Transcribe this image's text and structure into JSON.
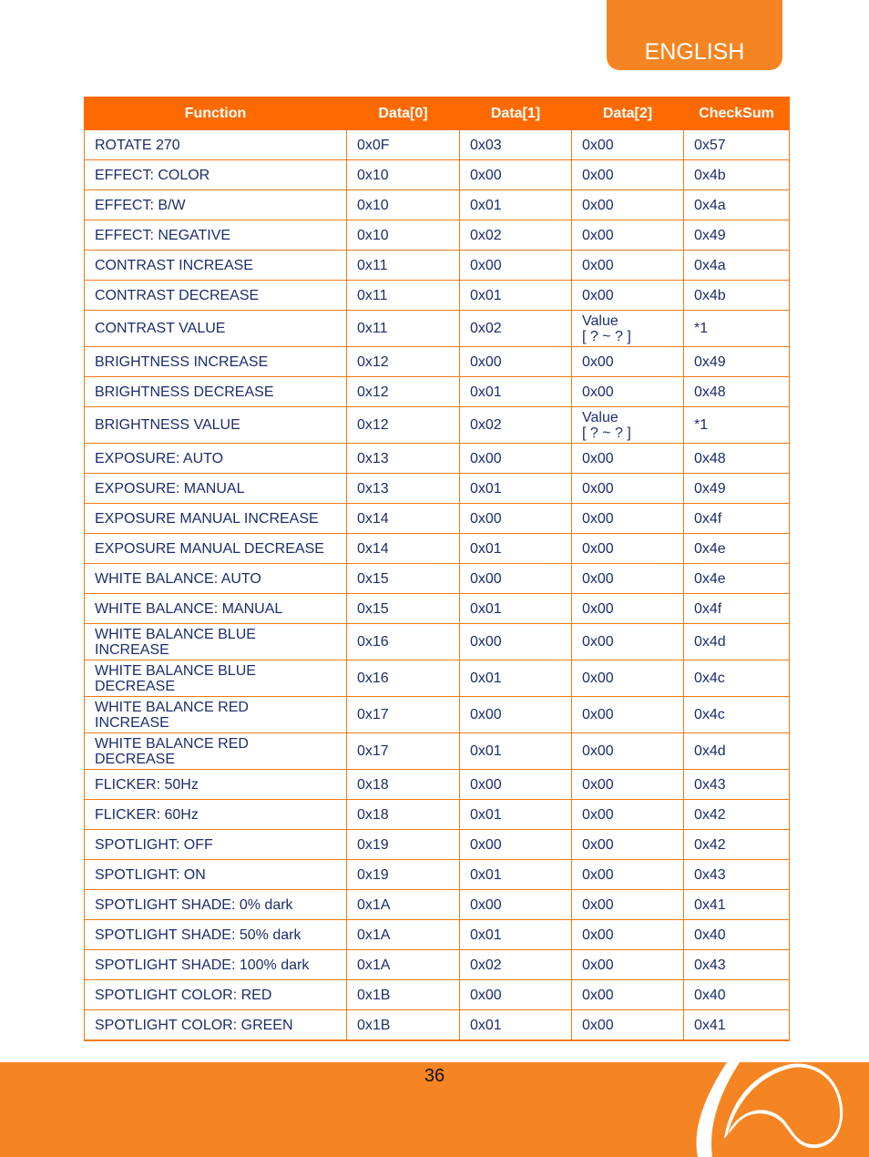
{
  "header": {
    "language_tab": "ENGLISH"
  },
  "table": {
    "columns": [
      "Function",
      "Data[0]",
      "Data[1]",
      "Data[2]",
      "CheckSum"
    ],
    "rows": [
      {
        "function": "ROTATE 270",
        "d0": "0x0F",
        "d1": "0x03",
        "d2": "0x00",
        "checksum": "0x57"
      },
      {
        "function": "EFFECT: COLOR",
        "d0": "0x10",
        "d1": "0x00",
        "d2": "0x00",
        "checksum": "0x4b"
      },
      {
        "function": "EFFECT: B/W",
        "d0": "0x10",
        "d1": "0x01",
        "d2": "0x00",
        "checksum": "0x4a"
      },
      {
        "function": "EFFECT: NEGATIVE",
        "d0": "0x10",
        "d1": "0x02",
        "d2": "0x00",
        "checksum": "0x49"
      },
      {
        "function": "CONTRAST INCREASE",
        "d0": "0x11",
        "d1": "0x00",
        "d2": "0x00",
        "checksum": "0x4a"
      },
      {
        "function": "CONTRAST DECREASE",
        "d0": "0x11",
        "d1": "0x01",
        "d2": "0x00",
        "checksum": "0x4b"
      },
      {
        "function": "CONTRAST VALUE",
        "d0": "0x11",
        "d1": "0x02",
        "d2": "Value\n[ ? ~ ? ]",
        "checksum": "*1"
      },
      {
        "function": "BRIGHTNESS INCREASE",
        "d0": "0x12",
        "d1": "0x00",
        "d2": "0x00",
        "checksum": "0x49"
      },
      {
        "function": "BRIGHTNESS DECREASE",
        "d0": "0x12",
        "d1": "0x01",
        "d2": "0x00",
        "checksum": "0x48"
      },
      {
        "function": "BRIGHTNESS VALUE",
        "d0": "0x12",
        "d1": "0x02",
        "d2": "Value\n[ ? ~ ? ]",
        "checksum": "*1"
      },
      {
        "function": "EXPOSURE: AUTO",
        "d0": "0x13",
        "d1": "0x00",
        "d2": "0x00",
        "checksum": "0x48"
      },
      {
        "function": "EXPOSURE: MANUAL",
        "d0": "0x13",
        "d1": "0x01",
        "d2": "0x00",
        "checksum": "0x49"
      },
      {
        "function": "EXPOSURE MANUAL INCREASE",
        "d0": "0x14",
        "d1": "0x00",
        "d2": "0x00",
        "checksum": "0x4f"
      },
      {
        "function": "EXPOSURE MANUAL DECREASE",
        "d0": "0x14",
        "d1": "0x01",
        "d2": "0x00",
        "checksum": "0x4e"
      },
      {
        "function": "WHITE BALANCE: AUTO",
        "d0": "0x15",
        "d1": "0x00",
        "d2": "0x00",
        "checksum": "0x4e"
      },
      {
        "function": "WHITE BALANCE: MANUAL",
        "d0": "0x15",
        "d1": "0x01",
        "d2": "0x00",
        "checksum": "0x4f"
      },
      {
        "function": "WHITE BALANCE BLUE INCREASE",
        "d0": "0x16",
        "d1": "0x00",
        "d2": "0x00",
        "checksum": "0x4d"
      },
      {
        "function": "WHITE BALANCE BLUE DECREASE",
        "d0": "0x16",
        "d1": "0x01",
        "d2": "0x00",
        "checksum": "0x4c"
      },
      {
        "function": "WHITE BALANCE RED INCREASE",
        "d0": "0x17",
        "d1": "0x00",
        "d2": "0x00",
        "checksum": "0x4c"
      },
      {
        "function": "WHITE BALANCE RED DECREASE",
        "d0": "0x17",
        "d1": "0x01",
        "d2": "0x00",
        "checksum": "0x4d"
      },
      {
        "function": "FLICKER: 50Hz",
        "d0": "0x18",
        "d1": "0x00",
        "d2": "0x00",
        "checksum": "0x43"
      },
      {
        "function": "FLICKER: 60Hz",
        "d0": "0x18",
        "d1": "0x01",
        "d2": "0x00",
        "checksum": "0x42"
      },
      {
        "function": "SPOTLIGHT: OFF",
        "d0": "0x19",
        "d1": "0x00",
        "d2": "0x00",
        "checksum": "0x42"
      },
      {
        "function": "SPOTLIGHT: ON",
        "d0": "0x19",
        "d1": "0x01",
        "d2": "0x00",
        "checksum": "0x43"
      },
      {
        "function": "SPOTLIGHT SHADE: 0% dark",
        "d0": "0x1A",
        "d1": "0x00",
        "d2": "0x00",
        "checksum": "0x41"
      },
      {
        "function": "SPOTLIGHT SHADE: 50% dark",
        "d0": "0x1A",
        "d1": "0x01",
        "d2": "0x00",
        "checksum": "0x40"
      },
      {
        "function": "SPOTLIGHT SHADE: 100% dark",
        "d0": "0x1A",
        "d1": "0x02",
        "d2": "0x00",
        "checksum": "0x43"
      },
      {
        "function": "SPOTLIGHT COLOR: RED",
        "d0": "0x1B",
        "d1": "0x00",
        "d2": "0x00",
        "checksum": "0x40"
      },
      {
        "function": "SPOTLIGHT COLOR: GREEN",
        "d0": "0x1B",
        "d1": "0x01",
        "d2": "0x00",
        "checksum": "0x41"
      }
    ]
  },
  "footer": {
    "page_number": "36"
  },
  "colors": {
    "accent": "#f58522",
    "header_fill": "#ff6a00",
    "text": "#1d2d6b"
  }
}
